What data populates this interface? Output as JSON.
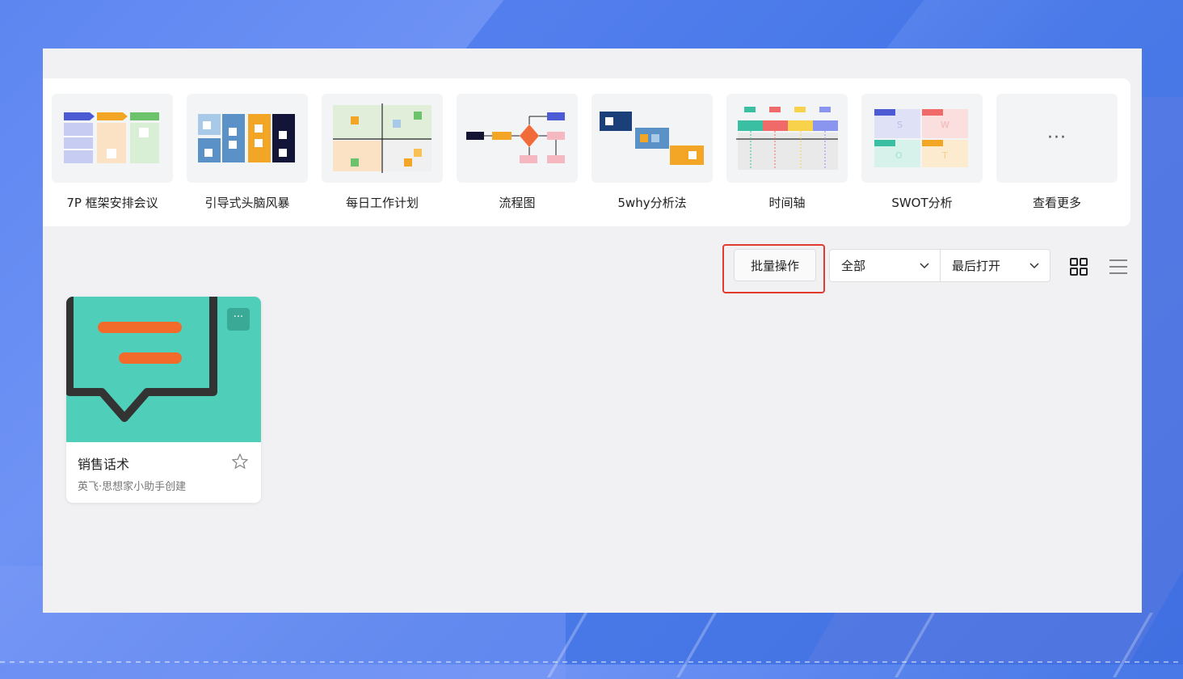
{
  "templates": [
    {
      "label": "7P 框架安排会议"
    },
    {
      "label": "引导式头脑风暴"
    },
    {
      "label": "每日工作计划"
    },
    {
      "label": "流程图"
    },
    {
      "label": "5why分析法"
    },
    {
      "label": "时间轴"
    },
    {
      "label": "SWOT分析"
    },
    {
      "label": "查看更多",
      "icon_text": "···"
    }
  ],
  "toolbar": {
    "batch_label": "批量操作",
    "filter_value": "全部",
    "sort_value": "最后打开"
  },
  "files": [
    {
      "title": "销售话术",
      "meta": "英飞·思想家小助手创建",
      "menu_text": "···"
    }
  ],
  "colors": {
    "highlight": "#e23a2e",
    "card_cover": "#4fcfb9",
    "accent_orange": "#f26b2a"
  }
}
